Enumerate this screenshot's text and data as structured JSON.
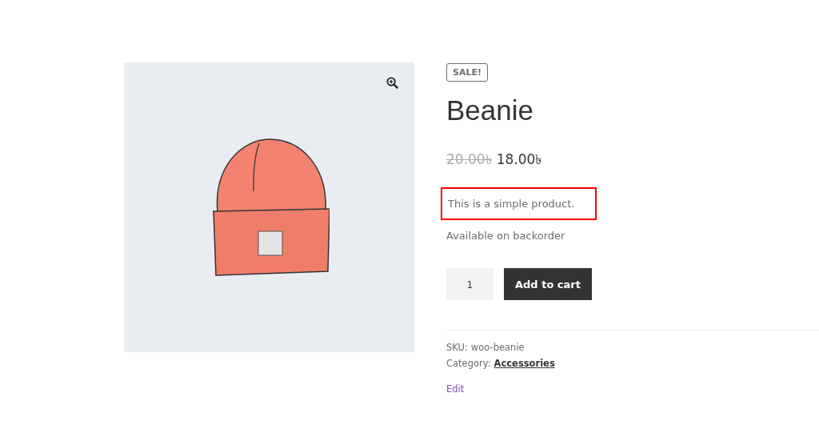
{
  "badge": "SALE!",
  "title": "Beanie",
  "price": {
    "regular": "20.00৳",
    "sale": "18.00৳"
  },
  "description": {
    "text": "This is a simple product.",
    "highlighted": true
  },
  "stock": "Available on backorder",
  "quantity": {
    "value": "1"
  },
  "add_to_cart": "Add to cart",
  "meta": {
    "sku_label": "SKU:",
    "sku": "woo-beanie",
    "category_label": "Category:",
    "category": "Accessories"
  },
  "edit_link": "Edit"
}
